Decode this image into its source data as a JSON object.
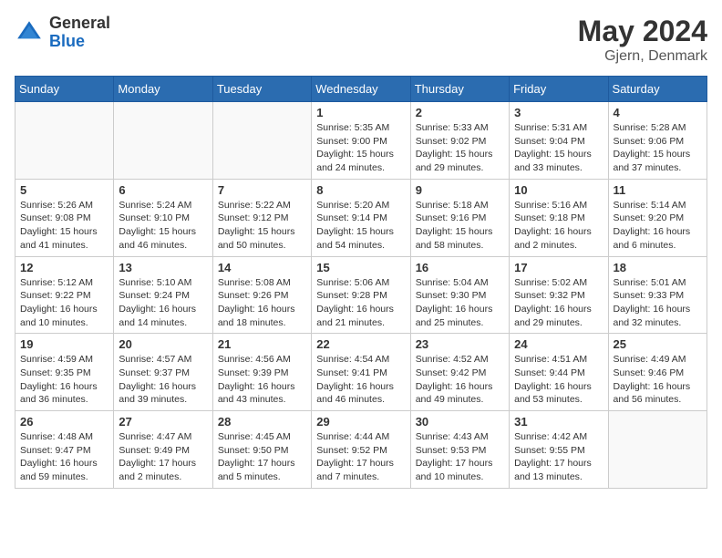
{
  "header": {
    "logo_general": "General",
    "logo_blue": "Blue",
    "month_year": "May 2024",
    "location": "Gjern, Denmark"
  },
  "days_of_week": [
    "Sunday",
    "Monday",
    "Tuesday",
    "Wednesday",
    "Thursday",
    "Friday",
    "Saturday"
  ],
  "weeks": [
    [
      {
        "day": "",
        "info": ""
      },
      {
        "day": "",
        "info": ""
      },
      {
        "day": "",
        "info": ""
      },
      {
        "day": "1",
        "info": "Sunrise: 5:35 AM\nSunset: 9:00 PM\nDaylight: 15 hours and 24 minutes."
      },
      {
        "day": "2",
        "info": "Sunrise: 5:33 AM\nSunset: 9:02 PM\nDaylight: 15 hours and 29 minutes."
      },
      {
        "day": "3",
        "info": "Sunrise: 5:31 AM\nSunset: 9:04 PM\nDaylight: 15 hours and 33 minutes."
      },
      {
        "day": "4",
        "info": "Sunrise: 5:28 AM\nSunset: 9:06 PM\nDaylight: 15 hours and 37 minutes."
      }
    ],
    [
      {
        "day": "5",
        "info": "Sunrise: 5:26 AM\nSunset: 9:08 PM\nDaylight: 15 hours and 41 minutes."
      },
      {
        "day": "6",
        "info": "Sunrise: 5:24 AM\nSunset: 9:10 PM\nDaylight: 15 hours and 46 minutes."
      },
      {
        "day": "7",
        "info": "Sunrise: 5:22 AM\nSunset: 9:12 PM\nDaylight: 15 hours and 50 minutes."
      },
      {
        "day": "8",
        "info": "Sunrise: 5:20 AM\nSunset: 9:14 PM\nDaylight: 15 hours and 54 minutes."
      },
      {
        "day": "9",
        "info": "Sunrise: 5:18 AM\nSunset: 9:16 PM\nDaylight: 15 hours and 58 minutes."
      },
      {
        "day": "10",
        "info": "Sunrise: 5:16 AM\nSunset: 9:18 PM\nDaylight: 16 hours and 2 minutes."
      },
      {
        "day": "11",
        "info": "Sunrise: 5:14 AM\nSunset: 9:20 PM\nDaylight: 16 hours and 6 minutes."
      }
    ],
    [
      {
        "day": "12",
        "info": "Sunrise: 5:12 AM\nSunset: 9:22 PM\nDaylight: 16 hours and 10 minutes."
      },
      {
        "day": "13",
        "info": "Sunrise: 5:10 AM\nSunset: 9:24 PM\nDaylight: 16 hours and 14 minutes."
      },
      {
        "day": "14",
        "info": "Sunrise: 5:08 AM\nSunset: 9:26 PM\nDaylight: 16 hours and 18 minutes."
      },
      {
        "day": "15",
        "info": "Sunrise: 5:06 AM\nSunset: 9:28 PM\nDaylight: 16 hours and 21 minutes."
      },
      {
        "day": "16",
        "info": "Sunrise: 5:04 AM\nSunset: 9:30 PM\nDaylight: 16 hours and 25 minutes."
      },
      {
        "day": "17",
        "info": "Sunrise: 5:02 AM\nSunset: 9:32 PM\nDaylight: 16 hours and 29 minutes."
      },
      {
        "day": "18",
        "info": "Sunrise: 5:01 AM\nSunset: 9:33 PM\nDaylight: 16 hours and 32 minutes."
      }
    ],
    [
      {
        "day": "19",
        "info": "Sunrise: 4:59 AM\nSunset: 9:35 PM\nDaylight: 16 hours and 36 minutes."
      },
      {
        "day": "20",
        "info": "Sunrise: 4:57 AM\nSunset: 9:37 PM\nDaylight: 16 hours and 39 minutes."
      },
      {
        "day": "21",
        "info": "Sunrise: 4:56 AM\nSunset: 9:39 PM\nDaylight: 16 hours and 43 minutes."
      },
      {
        "day": "22",
        "info": "Sunrise: 4:54 AM\nSunset: 9:41 PM\nDaylight: 16 hours and 46 minutes."
      },
      {
        "day": "23",
        "info": "Sunrise: 4:52 AM\nSunset: 9:42 PM\nDaylight: 16 hours and 49 minutes."
      },
      {
        "day": "24",
        "info": "Sunrise: 4:51 AM\nSunset: 9:44 PM\nDaylight: 16 hours and 53 minutes."
      },
      {
        "day": "25",
        "info": "Sunrise: 4:49 AM\nSunset: 9:46 PM\nDaylight: 16 hours and 56 minutes."
      }
    ],
    [
      {
        "day": "26",
        "info": "Sunrise: 4:48 AM\nSunset: 9:47 PM\nDaylight: 16 hours and 59 minutes."
      },
      {
        "day": "27",
        "info": "Sunrise: 4:47 AM\nSunset: 9:49 PM\nDaylight: 17 hours and 2 minutes."
      },
      {
        "day": "28",
        "info": "Sunrise: 4:45 AM\nSunset: 9:50 PM\nDaylight: 17 hours and 5 minutes."
      },
      {
        "day": "29",
        "info": "Sunrise: 4:44 AM\nSunset: 9:52 PM\nDaylight: 17 hours and 7 minutes."
      },
      {
        "day": "30",
        "info": "Sunrise: 4:43 AM\nSunset: 9:53 PM\nDaylight: 17 hours and 10 minutes."
      },
      {
        "day": "31",
        "info": "Sunrise: 4:42 AM\nSunset: 9:55 PM\nDaylight: 17 hours and 13 minutes."
      },
      {
        "day": "",
        "info": ""
      }
    ]
  ]
}
